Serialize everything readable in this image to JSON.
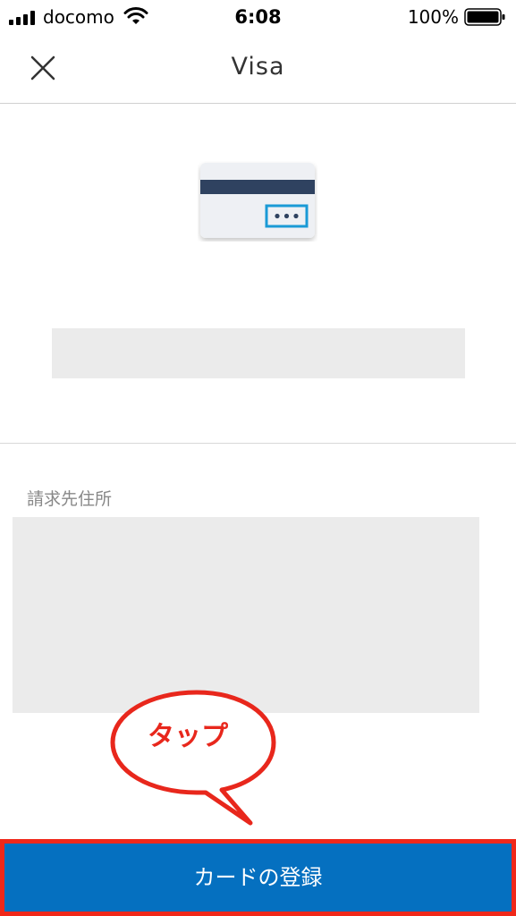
{
  "status_bar": {
    "carrier": "docomo",
    "time": "6:08",
    "battery": "100%"
  },
  "nav": {
    "title": "Visa",
    "close_icon": "close-icon"
  },
  "card": {
    "icon": "credit-card-icon"
  },
  "billing": {
    "label": "請求先住所"
  },
  "callout": {
    "text": "タップ"
  },
  "register_button": {
    "label": "カードの登録"
  },
  "colors": {
    "button_blue": "#0570c0",
    "highlight_red": "#f0281a",
    "card_stripe": "#2f4260",
    "card_accent": "#1a9ad6",
    "placeholder_gray": "#ebebeb"
  }
}
